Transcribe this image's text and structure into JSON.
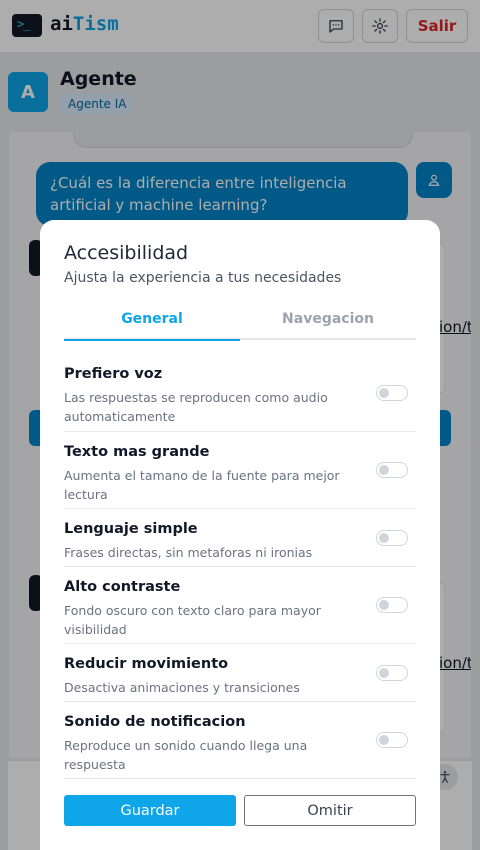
{
  "app": {
    "logo_glyph": ">_",
    "brand_ai": "ai",
    "brand_tism": "Tism",
    "logout_label": "Salir",
    "icons": [
      "chat-icon",
      "gear-icon"
    ]
  },
  "agent": {
    "avatar_letter": "A",
    "name": "Agente",
    "tag": "Agente IA"
  },
  "chat": {
    "user_message": "¿Cuál es la diferencia entre inteligencia artificial y machine learning?",
    "link_fragment_1": "ion/t",
    "link_fragment_2": "ion/t"
  },
  "modal": {
    "title": "Accesibilidad",
    "subtitle": "Ajusta la experiencia a tus necesidades",
    "tabs": [
      {
        "label": "General",
        "active": true
      },
      {
        "label": "Navegacion",
        "active": false
      }
    ],
    "settings": [
      {
        "title": "Prefiero voz",
        "desc": "Las respuestas se reproducen como audio automaticamente",
        "enabled": false
      },
      {
        "title": "Texto mas grande",
        "desc": "Aumenta el tamano de la fuente para mejor lectura",
        "enabled": false
      },
      {
        "title": "Lenguaje simple",
        "desc": "Frases directas, sin metaforas ni ironias",
        "enabled": false
      },
      {
        "title": "Alto contraste",
        "desc": "Fondo oscuro con texto claro para mayor visibilidad",
        "enabled": false
      },
      {
        "title": "Reducir movimiento",
        "desc": "Desactiva animaciones y transiciones",
        "enabled": false
      },
      {
        "title": "Sonido de notificacion",
        "desc": "Reproduce un sonido cuando llega una respuesta",
        "enabled": false
      }
    ],
    "save_label": "Guardar",
    "skip_label": "Omitir"
  },
  "colors": {
    "accent": "#0ea5e9",
    "user_bubble": "#0284c7",
    "danger": "#dc2626"
  }
}
